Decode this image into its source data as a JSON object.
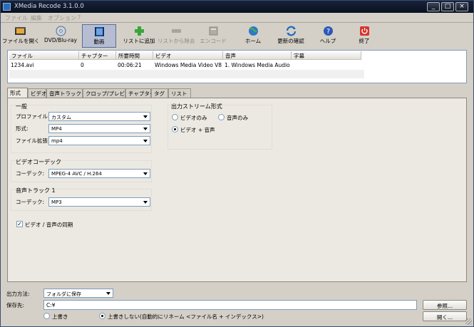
{
  "window": {
    "title": "XMedia Recode 3.1.0.0",
    "controls": [
      "_",
      "□",
      "×"
    ]
  },
  "menu": [
    "ファイル",
    "編集",
    "オプション",
    "?"
  ],
  "toolbar": [
    {
      "label": "ファイルを開く",
      "icon": "film-open-icon",
      "disabled": false
    },
    {
      "label": "DVD/Blu-ray",
      "icon": "disc-icon",
      "disabled": false
    },
    {
      "label": "動画",
      "icon": "video-icon",
      "disabled": false,
      "active": true
    },
    {
      "label": "リストに追加",
      "icon": "add-icon",
      "disabled": false
    },
    {
      "label": "リストから除去",
      "icon": "remove-icon",
      "disabled": true
    },
    {
      "label": "エンコード",
      "icon": "encode-icon",
      "disabled": true
    },
    {
      "label": "ホーム",
      "icon": "globe-icon",
      "disabled": false
    },
    {
      "label": "更新の確認",
      "icon": "refresh-icon",
      "disabled": false
    },
    {
      "label": "ヘルプ",
      "icon": "help-icon",
      "disabled": false
    },
    {
      "label": "終了",
      "icon": "power-icon",
      "disabled": false
    }
  ],
  "file_list": {
    "columns": [
      "ファイル",
      "チャプター",
      "所要時間",
      "ビデオ",
      "音声",
      "字幕"
    ],
    "rows": [
      [
        "1234.avi",
        "0",
        "00:06:21",
        "Windows Media Video V8 ...",
        "1. Windows Media Audio V...",
        ""
      ]
    ]
  },
  "tabs": [
    "形式",
    "ビデオ",
    "音声トラック 1",
    "クロップ/プレビュー",
    "チャプター",
    "タグ",
    "リスト"
  ],
  "format_tab": {
    "general": {
      "title": "一般",
      "profile_label": "プロファイル:",
      "profile_value": "カスタム",
      "format_label": "形式:",
      "format_value": "MP4",
      "ext_label": "ファイル拡張",
      "ext_value": "mp4"
    },
    "video_codec": {
      "title": "ビデオコーデック",
      "codec_label": "コーデック:",
      "codec_value": "MPEG-4 AVC / H.264"
    },
    "audio_track": {
      "title": "音声トラック 1",
      "codec_label": "コーデック:",
      "codec_value": "MP3"
    },
    "sync_label": "ビデオ / 音声の同期",
    "sync_checked": true,
    "output_stream": {
      "title": "出力ストリーム形式",
      "options": [
        "ビデオのみ",
        "音声のみ",
        "ビデオ + 音声"
      ],
      "selected": "ビデオ + 音声"
    }
  },
  "output": {
    "method_label": "出力方法:",
    "method_value": "フォルダに保存",
    "dest_label": "保存先:",
    "dest_value": "C:¥",
    "browse_button": "参照...",
    "open_button": "開く...",
    "overwrite_options": [
      "上書き",
      "上書きしない(自動的にリネーム <ファイル名 + インデックス>)"
    ],
    "overwrite_selected": "上書きしない(自動的にリネーム <ファイル名 + インデックス>)"
  },
  "colors": {
    "title_bg": "#0d1828",
    "window_bg": "#d4d0c8",
    "panel_bg": "#ece9e2",
    "border": "#7f9db9"
  }
}
